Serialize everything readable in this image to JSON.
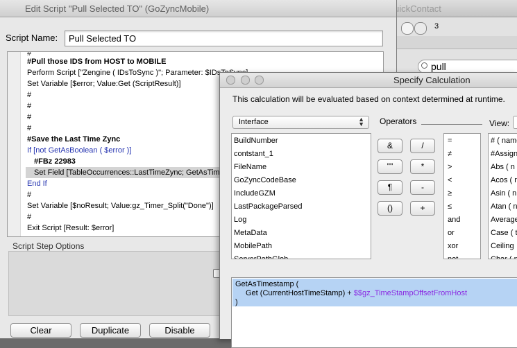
{
  "background_window": {
    "title_fragment": "uickContact",
    "count": "3",
    "search_value": "pull"
  },
  "edit_script": {
    "window_title": "Edit Script \"Pull Selected TO\" (GoZyncMobile)",
    "script_name_label": "Script Name:",
    "script_name_value": "Pull Selected TO",
    "lines": [
      {
        "text": "#",
        "style": "normal"
      },
      {
        "text": "#Pull those IDS from HOST to MOBILE",
        "style": "bold"
      },
      {
        "text": "Perform Script [\"Zengine ( IDsToSync )\"; Parameter: $IDsToSync]",
        "style": "normal"
      },
      {
        "text": "Set Variable [$error; Value:Get (ScriptResult)]",
        "style": "normal"
      },
      {
        "text": "#",
        "style": "normal"
      },
      {
        "text": "#",
        "style": "normal"
      },
      {
        "text": "#",
        "style": "normal"
      },
      {
        "text": "#",
        "style": "normal"
      },
      {
        "text": "#Save the Last Time Zync",
        "style": "bold"
      },
      {
        "text": "If [not GetAsBoolean ( $error )]",
        "style": "blue"
      },
      {
        "text": "#FBz 22983",
        "style": "bold-indent"
      },
      {
        "text": "Set Field [TableOccurrences::LastTimeZync; GetAsTimestamp (",
        "style": "selected"
      },
      {
        "text": "End If",
        "style": "blue"
      },
      {
        "text": "#",
        "style": "normal"
      },
      {
        "text": "Set Variable [$noResult; Value:gz_Timer_Split(\"Done\")]",
        "style": "normal"
      },
      {
        "text": "#",
        "style": "normal"
      },
      {
        "text": "Exit Script [Result: $error]",
        "style": "normal"
      }
    ],
    "options_label": "Script Step Options",
    "buttons": {
      "clear": "Clear",
      "duplicate": "Duplicate",
      "disable": "Disable"
    }
  },
  "calc": {
    "window_title": "Specify Calculation",
    "description": "This calculation will be evaluated based on context determined at runtime.",
    "table_select": "Interface",
    "fields": [
      "BuildNumber",
      "contstant_1",
      "FileName",
      "GoZyncCodeBase",
      "IncludeGZM",
      "LastPackageParsed",
      "Log",
      "MetaData",
      "MobilePath",
      "ServerPathGlob"
    ],
    "operators_label": "Operators",
    "op_buttons": [
      "&",
      "/",
      "\"\"",
      "*",
      "¶",
      "-",
      "()",
      "+"
    ],
    "op_list": [
      "=",
      "≠",
      ">",
      "<",
      "≥",
      "≤",
      "and",
      "or",
      "xor",
      "not"
    ],
    "view_label": "View:",
    "functions": [
      "# ( name",
      "#Assign",
      "Abs ( n",
      "Acos ( n",
      "Asin ( n",
      "Atan ( n",
      "Average",
      "Case ( t",
      "Ceiling",
      "Char ( n"
    ],
    "formula": {
      "line1": "GetAsTimestamp (",
      "line2_prefix": "Get (CurrentHostTimeStamp) + ",
      "line2_var": "$$gz_TimeStampOffsetFromHost",
      "line3": ")"
    }
  }
}
